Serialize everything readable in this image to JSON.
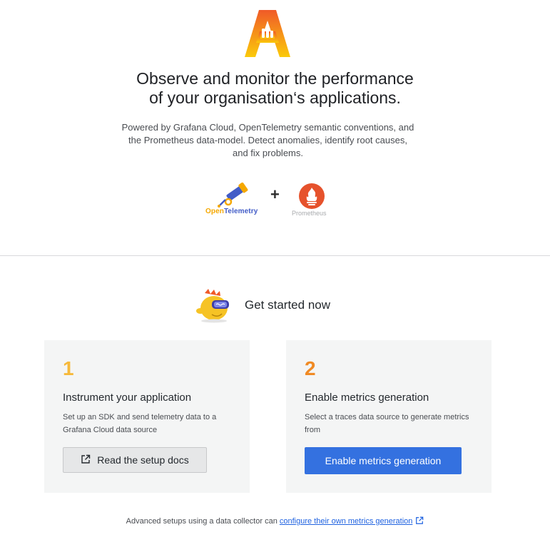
{
  "colors": {
    "accent_blue": "#3471e0",
    "link_blue": "#1f62e0",
    "card_bg": "#f4f5f5",
    "step1_color": "#f6b93b",
    "step2_color": "#f08a24",
    "prometheus_orange": "#e6522c"
  },
  "hero": {
    "logo_icon": "grafana-app-o11y-logo-icon",
    "headline_line1": "Observe and monitor the performance",
    "headline_line2": "of your organisation‘s applications.",
    "subtitle": "Powered by Grafana Cloud, OpenTelemetry semantic conventions, and the Prometheus data-model. Detect anomalies, identify root causes, and fix problems."
  },
  "partners": {
    "otel_label_open": "Open",
    "otel_label_telemetry": "Telemetry",
    "plus": "+",
    "prometheus_label": "Prometheus"
  },
  "get_started": {
    "title": "Get started now",
    "mascot_icon": "grot-mascot-icon"
  },
  "steps": [
    {
      "number": "1",
      "title": "Instrument your application",
      "description": "Set up an SDK and send telemetry data to a Grafana Cloud data source",
      "button_label": "Read the setup docs",
      "button_icon": "external-link-icon"
    },
    {
      "number": "2",
      "title": "Enable metrics generation",
      "description": "Select a traces data source to generate metrics from",
      "button_label": "Enable metrics generation"
    }
  ],
  "footer": {
    "text": "Advanced setups using a data collector can",
    "link_label": "configure their own metrics generation",
    "link_icon": "external-link-icon"
  }
}
